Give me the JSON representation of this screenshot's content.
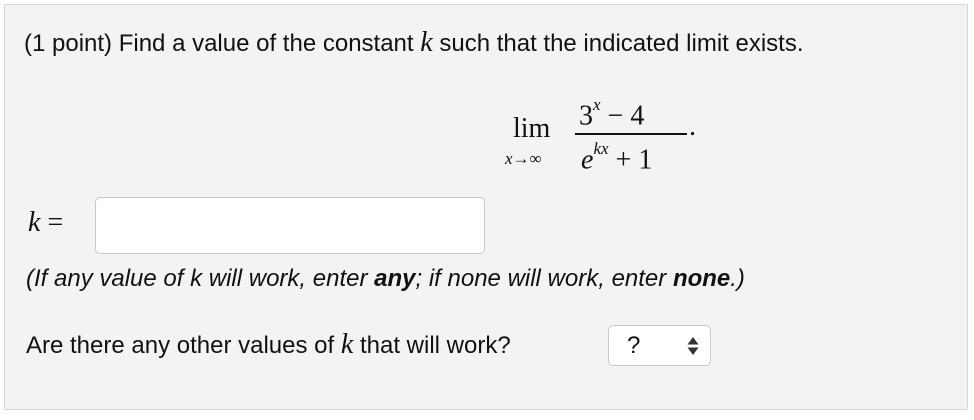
{
  "problem": {
    "prompt_before": "(1 point) Find a value of the constant ",
    "prompt_var": "k",
    "prompt_after": " such that the indicated limit exists.",
    "math": {
      "lim": "lim",
      "lim_sub_var": "x",
      "lim_sub_arrow": "→∞",
      "numerator_base": "3",
      "numerator_exp": "x",
      "numerator_rest": " − 4",
      "denominator_base": "e",
      "denominator_exp": "kx",
      "denominator_rest": " + 1",
      "period": "."
    }
  },
  "answer": {
    "label_var": "k",
    "label_eq": " =",
    "value": "",
    "placeholder": ""
  },
  "hint": {
    "part1": "(If any value of k will work, enter ",
    "any_word": "any",
    "part2": "; if none will work, enter ",
    "none_word": "none",
    "part3": ".)"
  },
  "question2": {
    "text_before": "Are there any other values of ",
    "var": "k",
    "text_after": " that will work?"
  },
  "select": {
    "selected": "?",
    "icon": "select-updown-arrows-icon"
  },
  "colors": {
    "panel_bg": "#f3f3f3",
    "panel_border": "#d6d6d6",
    "text": "#111111",
    "input_border": "#c9c9c9"
  }
}
